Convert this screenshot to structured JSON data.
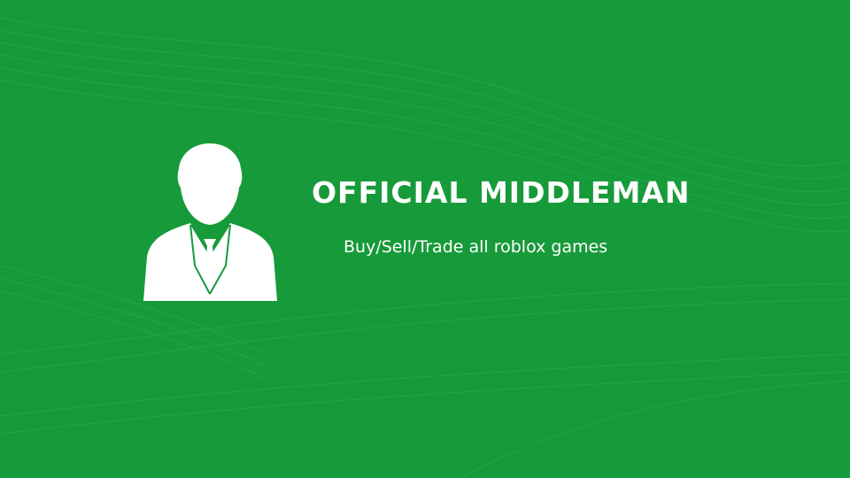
{
  "banner": {
    "title": "OFFICIAL MIDDLEMAN",
    "subtitle": "Buy/Sell/Trade all roblox games",
    "avatar_icon": "businessman-icon",
    "colors": {
      "background": "#179a3a",
      "background_lines": "#2fb04f",
      "text": "#ffffff",
      "icon": "#ffffff"
    }
  }
}
